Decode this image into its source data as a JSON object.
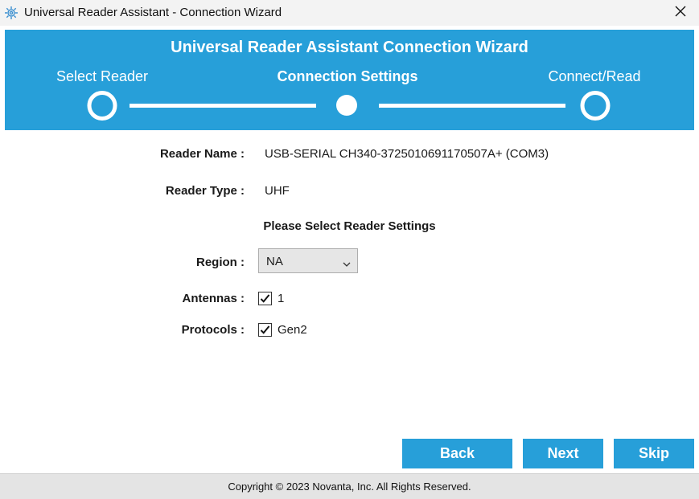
{
  "window": {
    "title": "Universal Reader Assistant - Connection Wizard",
    "app_icon": "gear-icon",
    "close_icon": "close-icon"
  },
  "header": {
    "title": "Universal Reader Assistant Connection Wizard",
    "steps": [
      {
        "label": "Select Reader",
        "active": false
      },
      {
        "label": "Connection Settings",
        "active": true
      },
      {
        "label": "Connect/Read",
        "active": false
      }
    ],
    "color": "#279fd9"
  },
  "form": {
    "reader_name_label": "Reader Name :",
    "reader_name_value": "USB-SERIAL CH340-3725010691170507A+ (COM3)",
    "reader_type_label": "Reader Type :",
    "reader_type_value": "UHF",
    "settings_heading": "Please Select Reader Settings",
    "region_label": "Region :",
    "region_value": "NA",
    "antennas_label": "Antennas :",
    "antenna_option": {
      "label": "1",
      "checked": true
    },
    "protocols_label": "Protocols :",
    "protocol_option": {
      "label": "Gen2",
      "checked": true
    }
  },
  "buttons": {
    "back": "Back",
    "next": "Next",
    "skip": "Skip"
  },
  "footer": {
    "copyright": "Copyright © 2023 Novanta, Inc. All Rights Reserved."
  }
}
